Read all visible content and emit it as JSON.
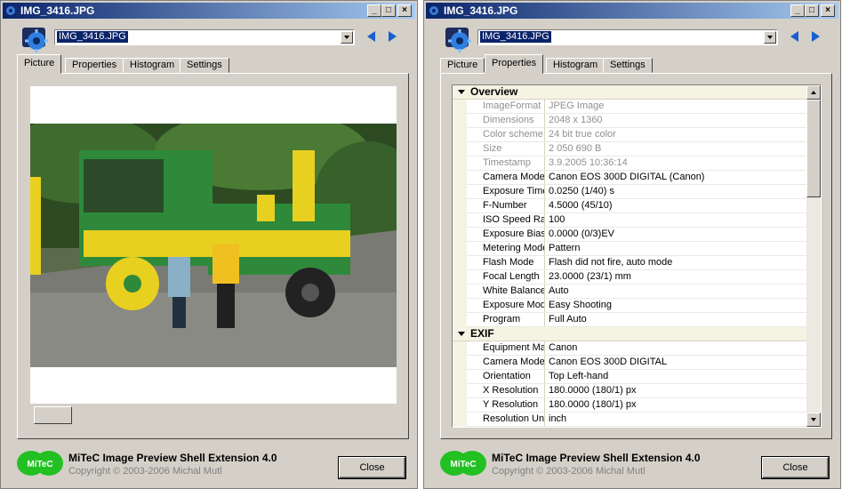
{
  "window_title": "IMG_3416.JPG",
  "file_combo_value": "IMG_3416.JPG",
  "tabs": [
    "Picture",
    "Properties",
    "Histogram",
    "Settings"
  ],
  "left_window": {
    "active_tab": "Picture"
  },
  "right_window": {
    "active_tab": "Properties"
  },
  "footer": {
    "logo_text": "MiTeC",
    "product": "MiTeC Image Preview Shell Extension 4.0",
    "copyright": "Copyright © 2003-2006 Michal Mutl",
    "close_label": "Close"
  },
  "properties": {
    "overview_title": "Overview",
    "overview": [
      {
        "k": "ImageFormat",
        "v": "JPEG Image",
        "ro": true
      },
      {
        "k": "Dimensions",
        "v": "2048 x 1360",
        "ro": true
      },
      {
        "k": "Color scheme",
        "v": "24 bit true color",
        "ro": true
      },
      {
        "k": "Size",
        "v": "2 050 690 B",
        "ro": true
      },
      {
        "k": "Timestamp",
        "v": "3.9.2005 10:36:14",
        "ro": true
      },
      {
        "k": "Camera Model",
        "v": "Canon EOS 300D DIGITAL (Canon)",
        "ro": false
      },
      {
        "k": "Exposure Time",
        "v": "0.0250 (1/40) s",
        "ro": false
      },
      {
        "k": "F-Number",
        "v": "4.5000 (45/10)",
        "ro": false
      },
      {
        "k": "ISO Speed Rat...",
        "v": "100",
        "ro": false
      },
      {
        "k": "Exposure Bias",
        "v": "0.0000 (0/3)EV",
        "ro": false
      },
      {
        "k": "Metering Mode",
        "v": "Pattern",
        "ro": false
      },
      {
        "k": "Flash Mode",
        "v": "Flash did not fire, auto mode",
        "ro": false
      },
      {
        "k": "Focal Length",
        "v": "23.0000 (23/1) mm",
        "ro": false
      },
      {
        "k": "White Balance",
        "v": "Auto",
        "ro": false
      },
      {
        "k": "Exposure Mode",
        "v": "Easy Shooting",
        "ro": false
      },
      {
        "k": "Program",
        "v": "Full Auto",
        "ro": false
      }
    ],
    "exif_title": "EXIF",
    "exif": [
      {
        "k": "Equipment Make",
        "v": "Canon",
        "ro": false
      },
      {
        "k": "Camera Model",
        "v": "Canon EOS 300D DIGITAL",
        "ro": false
      },
      {
        "k": "Orientation",
        "v": "Top Left-hand",
        "ro": false
      },
      {
        "k": "X Resolution",
        "v": "180.0000 (180/1) px",
        "ro": false
      },
      {
        "k": "Y Resolution",
        "v": "180.0000 (180/1) px",
        "ro": false
      },
      {
        "k": "Resolution Unit",
        "v": "inch",
        "ro": false
      }
    ]
  },
  "colors": {
    "title_start": "#0a246a",
    "title_end": "#a6caf0",
    "face": "#d4d0c8",
    "nav_arrow": "#1a5fd0",
    "logo_green": "#22c022"
  }
}
